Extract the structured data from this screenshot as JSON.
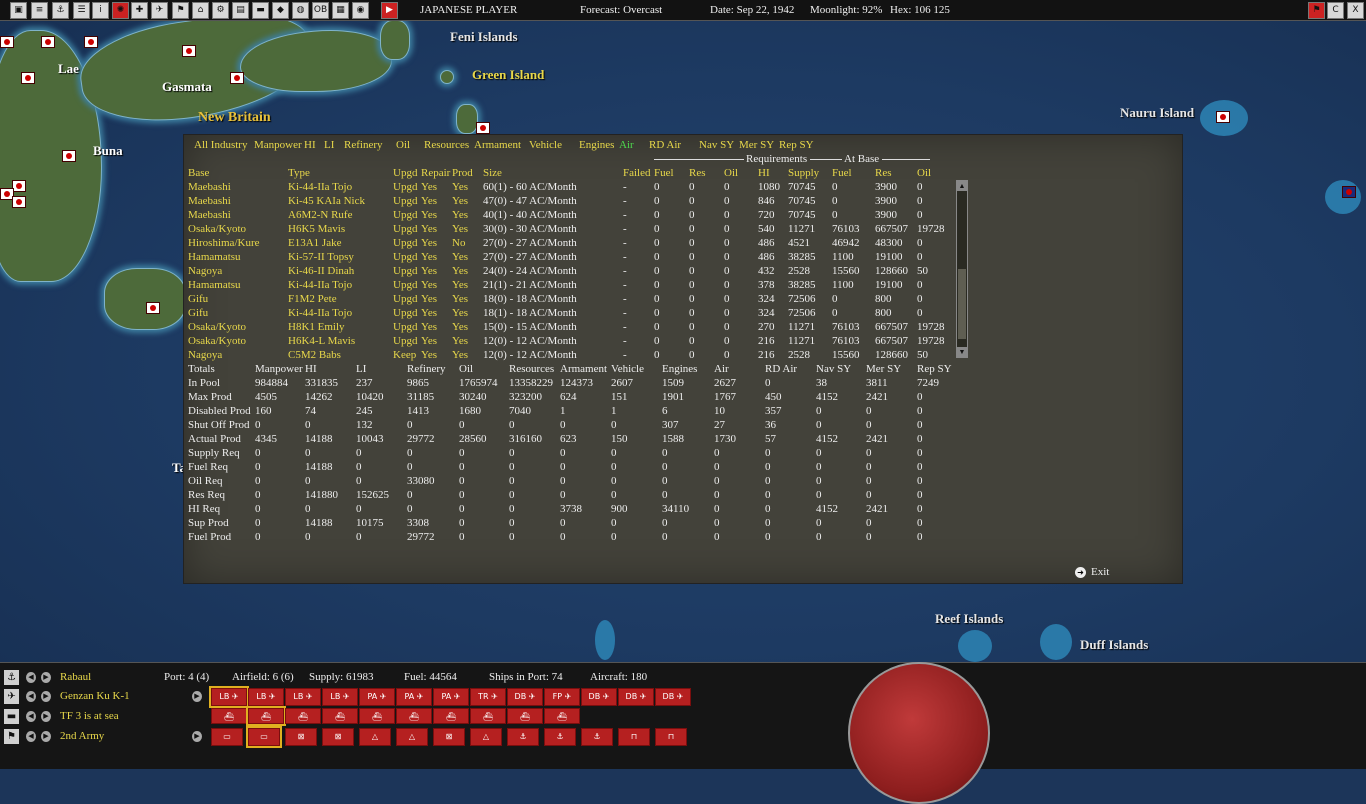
{
  "topbar": {
    "icons": [
      "map-icon",
      "list-icon",
      "ships-icon",
      "squad-icon",
      "info-icon",
      "flag-icon",
      "plus-icon",
      "plane-icon",
      "ensign-icon",
      "base-icon",
      "group-icon",
      "unit-icon",
      "ship-icon",
      "ship2-icon",
      "globe-icon",
      "ob-icon",
      "gear-icon",
      "eye-icon",
      "play-icon"
    ],
    "side": "JAPANESE PLAYER",
    "forecast": "Forecast: Overcast",
    "date": "Date: Sep 22, 1942",
    "moonlight": "Moonlight: 92%",
    "hex": "Hex: 106 125",
    "right_icons": [
      "flag-small",
      "C",
      "X"
    ]
  },
  "map": {
    "labels": {
      "feni": "Feni Islands",
      "green": "Green Island",
      "lae": "Lae",
      "gasmata": "Gasmata",
      "newbritain": "New Britain",
      "buna": "Buna",
      "nauru": "Nauru Island",
      "reef": "Reef Islands",
      "duff": "Duff Islands",
      "ta": "Ta"
    }
  },
  "panel": {
    "tabs": [
      "All Industry",
      "Manpower",
      "HI",
      "LI",
      "Refinery",
      "Oil",
      "Resources",
      "Armament",
      "Vehicle",
      "Engines",
      "Air",
      "RD Air",
      "Nav SY",
      "Mer SY",
      "Rep SY"
    ],
    "req_header": "Requirements",
    "atbase_header": "At Base",
    "headers": [
      "Base",
      "Type",
      "Upgd",
      "Repair",
      "Prod",
      "Size",
      "Failed",
      "Fuel",
      "Res",
      "Oil",
      "HI",
      "Supply",
      "Fuel",
      "Res",
      "Oil"
    ],
    "rows": [
      [
        "Maebashi",
        "Ki-44-IIa Tojo",
        "Upgd",
        "Yes",
        "Yes",
        "60(1) - 60 AC/Month",
        "-",
        "0",
        "0",
        "0",
        "1080",
        "70745",
        "0",
        "3900",
        "0"
      ],
      [
        "Maebashi",
        "Ki-45 KAIa Nick",
        "Upgd",
        "Yes",
        "Yes",
        "47(0) - 47 AC/Month",
        "-",
        "0",
        "0",
        "0",
        "846",
        "70745",
        "0",
        "3900",
        "0"
      ],
      [
        "Maebashi",
        "A6M2-N Rufe",
        "Upgd",
        "Yes",
        "Yes",
        "40(1) - 40 AC/Month",
        "-",
        "0",
        "0",
        "0",
        "720",
        "70745",
        "0",
        "3900",
        "0"
      ],
      [
        "Osaka/Kyoto",
        "H6K5 Mavis",
        "Upgd",
        "Yes",
        "Yes",
        "30(0) - 30 AC/Month",
        "-",
        "0",
        "0",
        "0",
        "540",
        "11271",
        "76103",
        "667507",
        "19728"
      ],
      [
        "Hiroshima/Kure",
        "E13A1 Jake",
        "Upgd",
        "Yes",
        "No",
        "27(0) - 27 AC/Month",
        "-",
        "0",
        "0",
        "0",
        "486",
        "4521",
        "46942",
        "48300",
        "0"
      ],
      [
        "Hamamatsu",
        "Ki-57-II Topsy",
        "Upgd",
        "Yes",
        "Yes",
        "27(0) - 27 AC/Month",
        "-",
        "0",
        "0",
        "0",
        "486",
        "38285",
        "1100",
        "19100",
        "0"
      ],
      [
        "Nagoya",
        "Ki-46-II Dinah",
        "Upgd",
        "Yes",
        "Yes",
        "24(0) - 24 AC/Month",
        "-",
        "0",
        "0",
        "0",
        "432",
        "2528",
        "15560",
        "128660",
        "50"
      ],
      [
        "Hamamatsu",
        "Ki-44-IIa Tojo",
        "Upgd",
        "Yes",
        "Yes",
        "21(1) - 21 AC/Month",
        "-",
        "0",
        "0",
        "0",
        "378",
        "38285",
        "1100",
        "19100",
        "0"
      ],
      [
        "Gifu",
        "F1M2 Pete",
        "Upgd",
        "Yes",
        "Yes",
        "18(0) - 18 AC/Month",
        "-",
        "0",
        "0",
        "0",
        "324",
        "72506",
        "0",
        "800",
        "0"
      ],
      [
        "Gifu",
        "Ki-44-IIa Tojo",
        "Upgd",
        "Yes",
        "Yes",
        "18(1) - 18 AC/Month",
        "-",
        "0",
        "0",
        "0",
        "324",
        "72506",
        "0",
        "800",
        "0"
      ],
      [
        "Osaka/Kyoto",
        "H8K1 Emily",
        "Upgd",
        "Yes",
        "Yes",
        "15(0) - 15 AC/Month",
        "-",
        "0",
        "0",
        "0",
        "270",
        "11271",
        "76103",
        "667507",
        "19728"
      ],
      [
        "Osaka/Kyoto",
        "H6K4-L Mavis",
        "Upgd",
        "Yes",
        "Yes",
        "12(0) - 12 AC/Month",
        "-",
        "0",
        "0",
        "0",
        "216",
        "11271",
        "76103",
        "667507",
        "19728"
      ],
      [
        "Nagoya",
        "C5M2 Babs",
        "Keep",
        "Yes",
        "Yes",
        "12(0) - 12 AC/Month",
        "-",
        "0",
        "0",
        "0",
        "216",
        "2528",
        "15560",
        "128660",
        "50"
      ]
    ],
    "totals_headers": [
      "Totals",
      "Manpower",
      "HI",
      "LI",
      "Refinery",
      "Oil",
      "Resources",
      "Armament",
      "Vehicle",
      "Engines",
      "Air",
      "RD Air",
      "Nav SY",
      "Mer SY",
      "Rep SY"
    ],
    "totals": [
      [
        "In Pool",
        "984884",
        "331835",
        "237",
        "9865",
        "1765974",
        "13358229",
        "124373",
        "2607",
        "1509",
        "2627",
        "0",
        "38",
        "3811",
        "7249"
      ],
      [
        "Max Prod",
        "4505",
        "14262",
        "10420",
        "31185",
        "30240",
        "323200",
        "624",
        "151",
        "1901",
        "1767",
        "450",
        "4152",
        "2421",
        "0"
      ],
      [
        "Disabled Prod",
        "160",
        "74",
        "245",
        "1413",
        "1680",
        "7040",
        "1",
        "1",
        "6",
        "10",
        "357",
        "0",
        "0",
        "0"
      ],
      [
        "Shut Off Prod",
        "0",
        "0",
        "132",
        "0",
        "0",
        "0",
        "0",
        "0",
        "307",
        "27",
        "36",
        "0",
        "0",
        "0"
      ],
      [
        "Actual Prod",
        "4345",
        "14188",
        "10043",
        "29772",
        "28560",
        "316160",
        "623",
        "150",
        "1588",
        "1730",
        "57",
        "4152",
        "2421",
        "0"
      ],
      [
        "Supply Req",
        "0",
        "0",
        "0",
        "0",
        "0",
        "0",
        "0",
        "0",
        "0",
        "0",
        "0",
        "0",
        "0",
        "0"
      ],
      [
        "Fuel Req",
        "0",
        "14188",
        "0",
        "0",
        "0",
        "0",
        "0",
        "0",
        "0",
        "0",
        "0",
        "0",
        "0",
        "0"
      ],
      [
        "Oil Req",
        "0",
        "0",
        "0",
        "33080",
        "0",
        "0",
        "0",
        "0",
        "0",
        "0",
        "0",
        "0",
        "0",
        "0"
      ],
      [
        "Res Req",
        "0",
        "141880",
        "152625",
        "0",
        "0",
        "0",
        "0",
        "0",
        "0",
        "0",
        "0",
        "0",
        "0",
        "0"
      ],
      [
        "HI Req",
        "0",
        "0",
        "0",
        "0",
        "0",
        "0",
        "3738",
        "900",
        "34110",
        "0",
        "0",
        "4152",
        "2421",
        "0"
      ],
      [
        "Sup Prod",
        "0",
        "14188",
        "10175",
        "3308",
        "0",
        "0",
        "0",
        "0",
        "0",
        "0",
        "0",
        "0",
        "0",
        "0"
      ],
      [
        "Fuel Prod",
        "0",
        "0",
        "0",
        "29772",
        "0",
        "0",
        "0",
        "0",
        "0",
        "0",
        "0",
        "0",
        "0",
        "0"
      ]
    ],
    "exit_label": "Exit"
  },
  "bottom": {
    "base": "Rabaul",
    "port": "Port: 4 (4)",
    "airfield": "Airfield: 6 (6)",
    "supply": "Supply: 61983",
    "fuel": "Fuel: 44564",
    "ships_in_port": "Ships in Port: 74",
    "aircraft": "Aircraft: 180",
    "air_unit": "Genzan Ku K-1",
    "task_force": "TF 3 is at sea",
    "army": "2nd Army",
    "air_chips": [
      "LB",
      "LB",
      "LB",
      "LB",
      "PA",
      "PA",
      "PA",
      "TR",
      "DB",
      "FP",
      "DB",
      "DB",
      "DB"
    ],
    "ship_count": 10,
    "unit_chips": [
      "inf-icon",
      "inf-icon",
      "x-icon",
      "x-icon",
      "tri-icon",
      "tri-icon",
      "x-icon",
      "tri-icon",
      "anchor-icon",
      "anchor-icon",
      "anchor-icon",
      "m-icon",
      "m-icon"
    ]
  }
}
